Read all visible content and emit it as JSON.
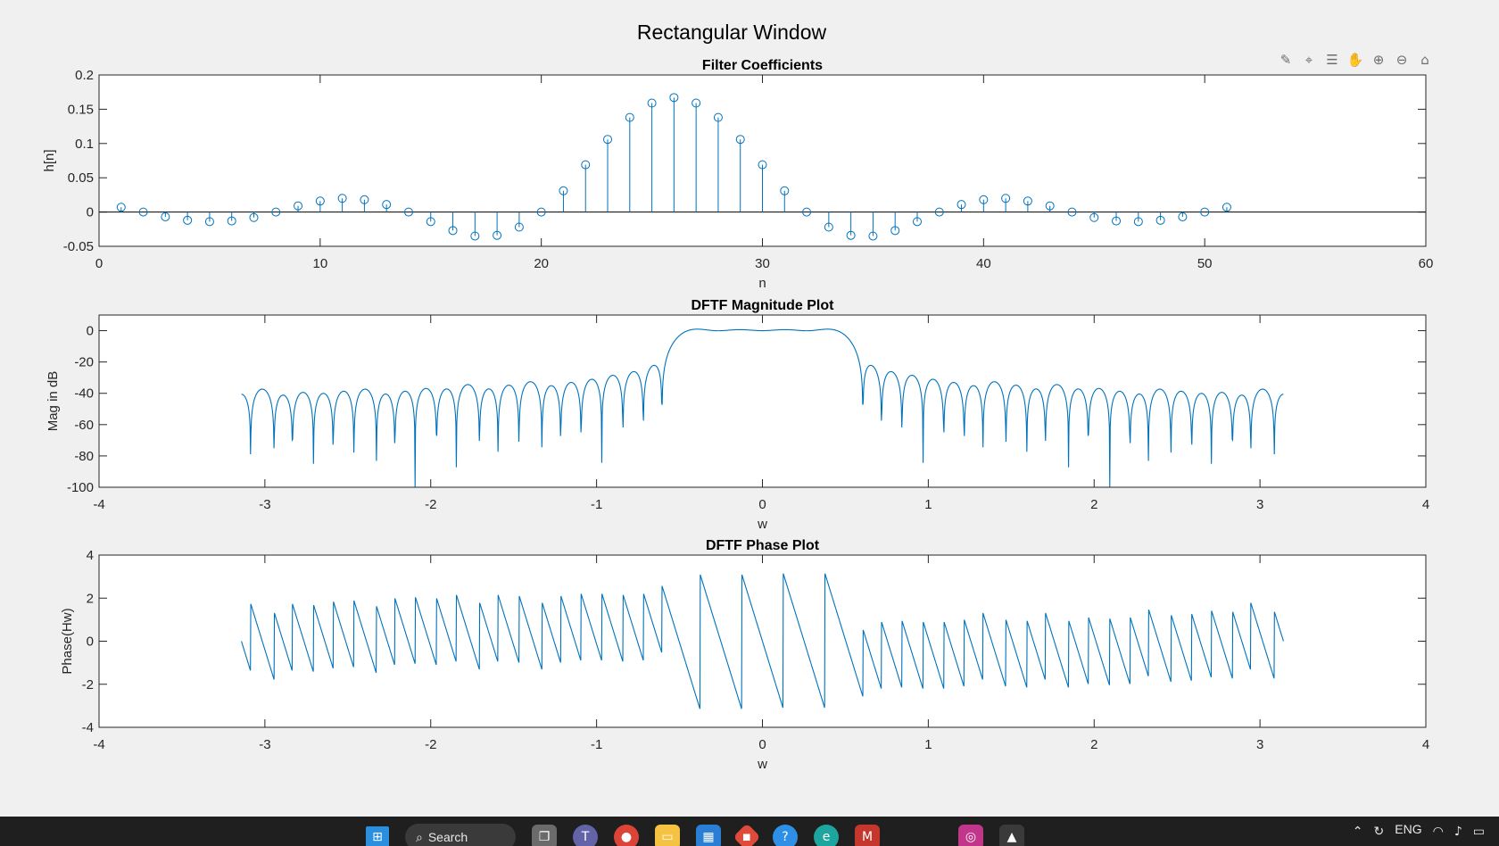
{
  "figure_title": "Rectangular Window",
  "toolbar": {
    "icons": [
      "brush-icon",
      "data-tips-icon",
      "legend-icon",
      "pan-icon",
      "zoom-in-icon",
      "zoom-out-icon",
      "home-icon"
    ]
  },
  "chart_data": [
    {
      "type": "stem",
      "title": "Filter Coefficients",
      "xlabel": "n",
      "ylabel": "h[n]",
      "xlim": [
        0,
        60
      ],
      "ylim": [
        -0.05,
        0.2
      ],
      "xticks": [
        "0",
        "10",
        "20",
        "30",
        "40",
        "50",
        "60"
      ],
      "yticks": [
        "-0.05",
        "0",
        "0.05",
        "0.1",
        "0.15",
        "0.2"
      ],
      "x": [
        1,
        2,
        3,
        4,
        5,
        6,
        7,
        8,
        9,
        10,
        11,
        12,
        13,
        14,
        15,
        16,
        17,
        18,
        19,
        20,
        21,
        22,
        23,
        24,
        25,
        26,
        27,
        28,
        29,
        30,
        31,
        32,
        33,
        34,
        35,
        36,
        37,
        38,
        39,
        40,
        41,
        42,
        43,
        44,
        45,
        46,
        47,
        48,
        49,
        50,
        51
      ],
      "values": [
        0.007,
        0.0,
        -0.007,
        -0.012,
        -0.014,
        -0.013,
        -0.008,
        0.0,
        0.009,
        0.016,
        0.02,
        0.018,
        0.011,
        0.0,
        -0.014,
        -0.027,
        -0.035,
        -0.034,
        -0.022,
        0.0,
        0.031,
        0.069,
        0.106,
        0.138,
        0.159,
        0.167,
        0.159,
        0.138,
        0.106,
        0.069,
        0.031,
        0.0,
        -0.022,
        -0.034,
        -0.035,
        -0.027,
        -0.014,
        0.0,
        0.011,
        0.018,
        0.02,
        0.016,
        0.009,
        0.0,
        -0.008,
        -0.013,
        -0.014,
        -0.012,
        -0.007,
        0.0,
        0.007
      ],
      "color": "#0072bd"
    },
    {
      "type": "line",
      "title": "DFTF Magnitude Plot",
      "xlabel": "w",
      "ylabel": "Mag in dB",
      "xlim": [
        -4,
        4
      ],
      "ylim": [
        -100,
        10
      ],
      "xticks": [
        "-4",
        "-3",
        "-2",
        "-1",
        "0",
        "1",
        "2",
        "3",
        "4"
      ],
      "yticks": [
        "-100",
        "-80",
        "-60",
        "-40",
        "-20",
        "0"
      ],
      "x_range": [
        -3.1416,
        3.1416
      ],
      "passband_edge": 0.6,
      "passband_level_db": 0,
      "sidelobe_level_db": -42,
      "null_depth_db": -62,
      "deepest_nulls": [
        {
          "w": -2.47,
          "db": -95
        },
        {
          "w": 2.47,
          "db": -95
        },
        {
          "w": -1.98,
          "db": -83
        },
        {
          "w": 1.98,
          "db": -83
        }
      ],
      "color": "#0072bd"
    },
    {
      "type": "line",
      "title": "DFTF Phase Plot",
      "xlabel": "w",
      "ylabel": "Phase(Hw)",
      "xlim": [
        -4,
        4
      ],
      "ylim": [
        -4,
        4
      ],
      "xticks": [
        "-4",
        "-3",
        "-2",
        "-1",
        "0",
        "1",
        "2",
        "3",
        "4"
      ],
      "yticks": [
        "-4",
        "-2",
        "0",
        "2",
        "4"
      ],
      "x_range": [
        -3.1416,
        3.1416
      ],
      "filter_length": 51,
      "passband_edge": 0.6,
      "color": "#0072bd"
    }
  ],
  "taskbar": {
    "search_label": "Search",
    "language": "ENG",
    "apps": [
      "windows-start-icon",
      "search",
      "task-view-icon",
      "teams-icon",
      "chrome-icon",
      "file-explorer-icon",
      "store-icon",
      "app-icon",
      "help-icon",
      "edge-icon",
      "gmail-icon",
      "instagram-icon",
      "matlab-icon"
    ]
  }
}
